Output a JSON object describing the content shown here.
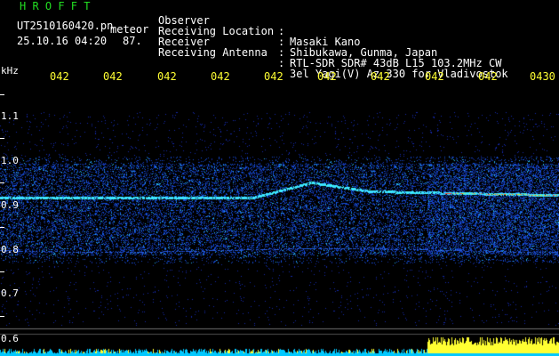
{
  "header": {
    "logo": "H R O F F T",
    "filename": "UT2510160420.pn",
    "tag": "meteor",
    "datetime": "25.10.16 04:20",
    "number": "87."
  },
  "info": [
    {
      "label": "Observer",
      "sep": ":",
      "value": "Masaki Kano"
    },
    {
      "label": "Receiving Location",
      "sep": ":",
      "value": "Shibukawa, Gunma, Japan"
    },
    {
      "label": "Receiver",
      "sep": ":",
      "value": "RTL-SDR SDR# 43dB L15 103.2MHz CW"
    },
    {
      "label": "Receiving Antenna",
      "sep": ":",
      "value": "3el Yagi(V) Az 330 for Vladivostok"
    }
  ],
  "axis": {
    "unit": "kHz",
    "time_ticks": [
      "042",
      "042",
      "042",
      "042",
      "042",
      "042",
      "042",
      "042",
      "042",
      "0430"
    ],
    "freq_labels": [
      "1.1",
      "1.0",
      "0.9",
      "0.8",
      "0.7",
      "0.6"
    ]
  },
  "colors": {
    "text_green": "#22dd22",
    "text_yellow": "#ffff33",
    "text_white": "#ffffff",
    "bg": "#000000",
    "noise_blue": "#1a2fd0",
    "signal_cyan": "#44e6ff",
    "signal_red": "#ff3030",
    "bars_cyan": "#00ccff",
    "bars_yellow": "#ffff33"
  }
}
